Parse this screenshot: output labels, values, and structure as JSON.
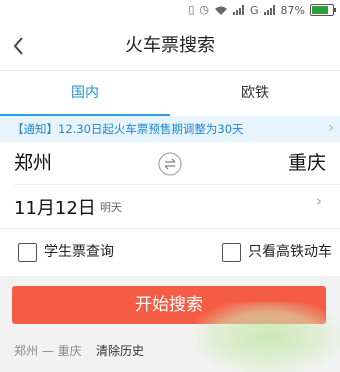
{
  "status_bar": {
    "signal_label": "G",
    "battery_percent": "87%",
    "battery_level": 0.87,
    "icons": [
      "vibrate-icon",
      "alarm-icon",
      "wifi-icon",
      "signal-icon",
      "signal-icon",
      "battery-icon"
    ]
  },
  "nav": {
    "title": "火车票搜索",
    "back_icon": "chevron-left-icon"
  },
  "tabs": [
    {
      "label": "国内",
      "active": true
    },
    {
      "label": "欧铁",
      "active": false
    }
  ],
  "notice": {
    "text": "【通知】12.30日起火车票预售期调整为30天"
  },
  "route": {
    "from_city": "郑州",
    "to_city": "重庆",
    "swap_icon": "swap-icon"
  },
  "date": {
    "value": "11月12日",
    "weekday": "明天"
  },
  "options": {
    "student_ticket": {
      "label": "学生票查询",
      "checked": false
    },
    "high_speed_only": {
      "label": "只看高铁动车",
      "checked": false
    }
  },
  "search_button": {
    "label": "开始搜索"
  },
  "history": {
    "last_route": "郑州 — 重庆",
    "clear_label": "清除历史"
  },
  "colors": {
    "accent": "#1e90d6",
    "button": "#f45d44",
    "notice_bg": "#e8f4fd"
  }
}
